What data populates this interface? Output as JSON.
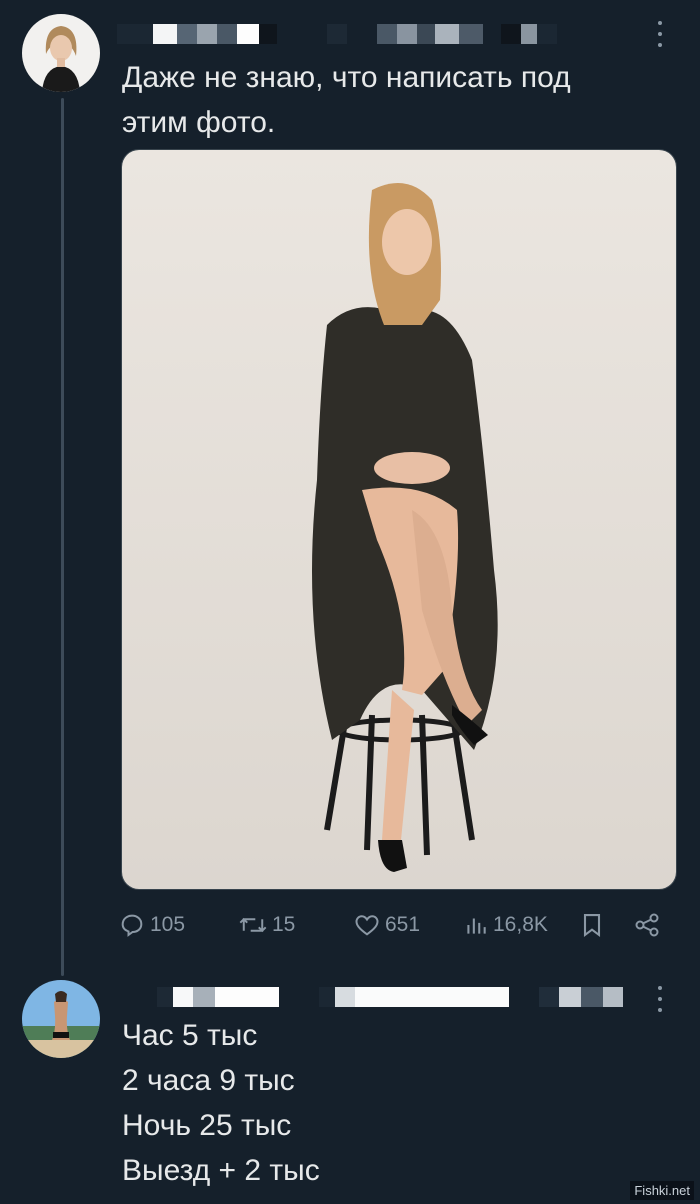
{
  "tweet1": {
    "text_lines": [
      "Даже не знаю, что написать под",
      "этим фото."
    ],
    "actions": {
      "replies": "105",
      "retweets": "15",
      "likes": "651",
      "views": "16,8K"
    }
  },
  "tweet2": {
    "text_lines": [
      "Час 5 тыс",
      "2 часа 9 тыс",
      "Ночь 25 тыс",
      "Выезд + 2 тыс"
    ]
  },
  "icons": [
    "reply-icon",
    "retweet-icon",
    "like-icon",
    "views-icon",
    "bookmark-icon",
    "share-icon",
    "more-icon"
  ],
  "colors": {
    "background": "#15202b",
    "text": "#e7e9ea",
    "muted": "#8b98a5"
  },
  "watermark": "Fishki.net"
}
